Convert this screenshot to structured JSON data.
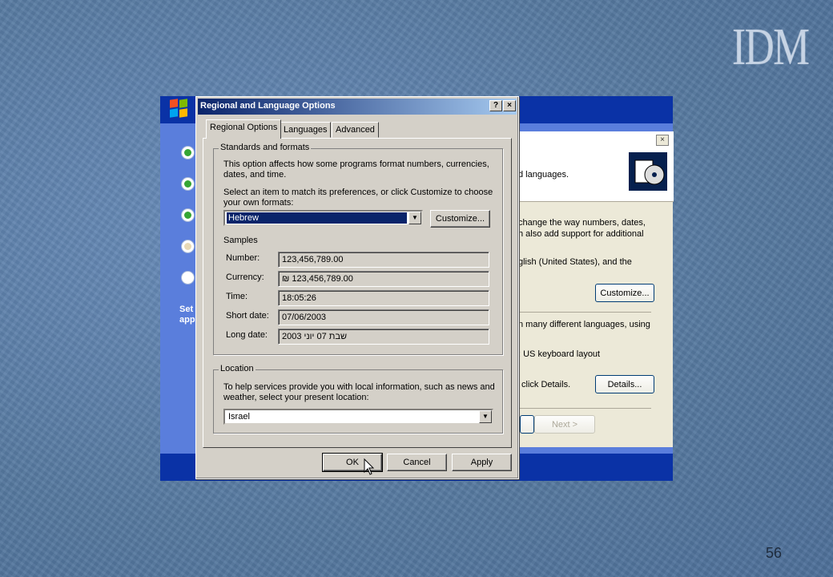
{
  "slide": {
    "logo": "IDM",
    "page_number": "56"
  },
  "setup_window": {
    "side_text": "Set\napp",
    "back_dialog": {
      "close_symbol": "×",
      "header_text": "d languages.",
      "para1_line1": "change the way numbers, dates,",
      "para1_line2": "h also add support for additional",
      "para2": "glish (United States), and the",
      "customize_label": "Customize...",
      "para3": "n many different languages, using",
      "keyboard_text": ": US keyboard layout",
      "details_text": "click Details.",
      "details_label": "Details...",
      "next_label": "Next >"
    }
  },
  "dialog": {
    "title": "Regional and Language Options",
    "help_symbol": "?",
    "close_symbol": "×",
    "tabs": [
      {
        "label": "Regional Options"
      },
      {
        "label": "Languages"
      },
      {
        "label": "Advanced"
      }
    ],
    "standards": {
      "legend": "Standards and formats",
      "desc_line1": "This option affects how some programs format numbers, currencies,",
      "desc_line2": "dates, and time.",
      "select_line1": "Select an item to match its preferences, or click Customize to choose",
      "select_line2": "your own formats:",
      "selected_format": "Hebrew",
      "customize_label": "Customize...",
      "samples_heading": "Samples",
      "samples": [
        {
          "label": "Number:",
          "value": "123,456,789.00"
        },
        {
          "label": "Currency:",
          "value": "₪ 123,456,789.00"
        },
        {
          "label": "Time:",
          "value": "18:05:26"
        },
        {
          "label": "Short date:",
          "value": "07/06/2003"
        },
        {
          "label": "Long date:",
          "value": "שבת 07 יוני 2003"
        }
      ]
    },
    "location": {
      "legend": "Location",
      "desc_line1": "To help services provide you with local information, such as news and",
      "desc_line2": "weather, select your present location:",
      "selected_location": "Israel"
    },
    "buttons": {
      "ok": "OK",
      "cancel": "Cancel",
      "apply": "Apply"
    }
  }
}
